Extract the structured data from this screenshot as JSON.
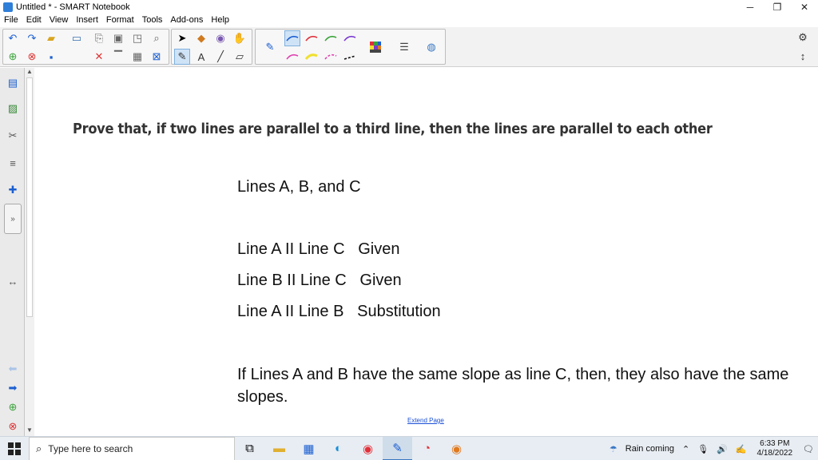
{
  "window": {
    "title": "Untitled * - SMART Notebook",
    "minimize": "─",
    "maximize": "❐",
    "close": "✕"
  },
  "menu": [
    "File",
    "Edit",
    "View",
    "Insert",
    "Format",
    "Tools",
    "Add-ons",
    "Help"
  ],
  "page": {
    "question": "Prove that, if two lines are parallel to a third line, then the lines are parallel to each other",
    "lines": [
      "Lines A, B, and C",
      "Line A II Line C   Given",
      "Line B II Line C   Given",
      "Line A II Line B   Substitution",
      "If Lines A and B have the same slope as line C, then, they also have the same slopes."
    ],
    "extend_link": "Extend Page"
  },
  "taskbar": {
    "search_placeholder": "Type here to search",
    "weather": "Rain coming",
    "time": "6:33 PM",
    "date": "4/18/2022"
  },
  "colors": {
    "accent": "#2f7fd8",
    "pen_blue": "#1b5fd1",
    "pen_red": "#e0303a",
    "pen_green": "#3aa33a",
    "pen_purple": "#7a3ad0",
    "pen_pink": "#e040b0",
    "pen_yellow": "#f0e030"
  }
}
